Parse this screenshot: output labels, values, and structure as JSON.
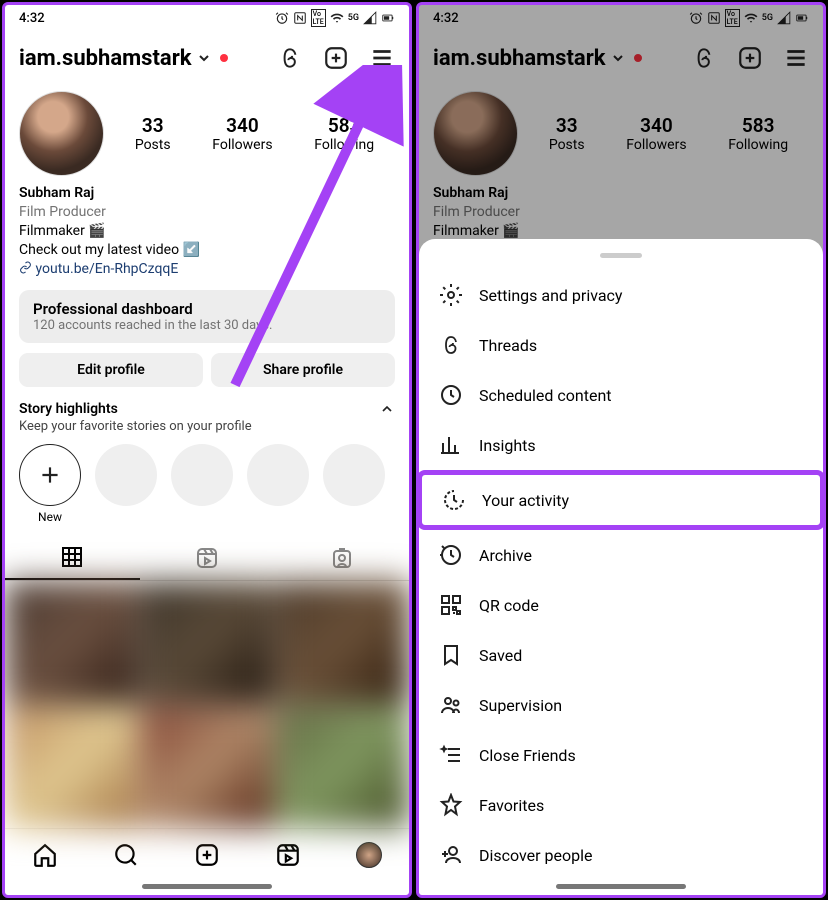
{
  "status": {
    "time": "4:32",
    "network": "5G"
  },
  "header": {
    "username": "iam.subhamstark"
  },
  "stats": {
    "posts": {
      "count": "33",
      "label": "Posts"
    },
    "followers": {
      "count": "340",
      "label": "Followers"
    },
    "following": {
      "count": "583",
      "label": "Following"
    }
  },
  "bio": {
    "name": "Subham Raj",
    "category": "Film Producer",
    "line1": "Filmmaker 🎬",
    "line2": "Check out my latest video ↙️",
    "link": "youtu.be/En-RhpCzqqE"
  },
  "dashboard": {
    "title": "Professional dashboard",
    "sub": "120 accounts reached in the last 30 days."
  },
  "buttons": {
    "edit": "Edit profile",
    "share": "Share profile"
  },
  "highlights": {
    "title": "Story highlights",
    "sub": "Keep your favorite stories on your profile",
    "new": "New"
  },
  "menu": {
    "settings": "Settings and privacy",
    "threads": "Threads",
    "scheduled": "Scheduled content",
    "insights": "Insights",
    "activity": "Your activity",
    "archive": "Archive",
    "qrcode": "QR code",
    "saved": "Saved",
    "supervision": "Supervision",
    "close_friends": "Close Friends",
    "favorites": "Favorites",
    "discover": "Discover people"
  }
}
